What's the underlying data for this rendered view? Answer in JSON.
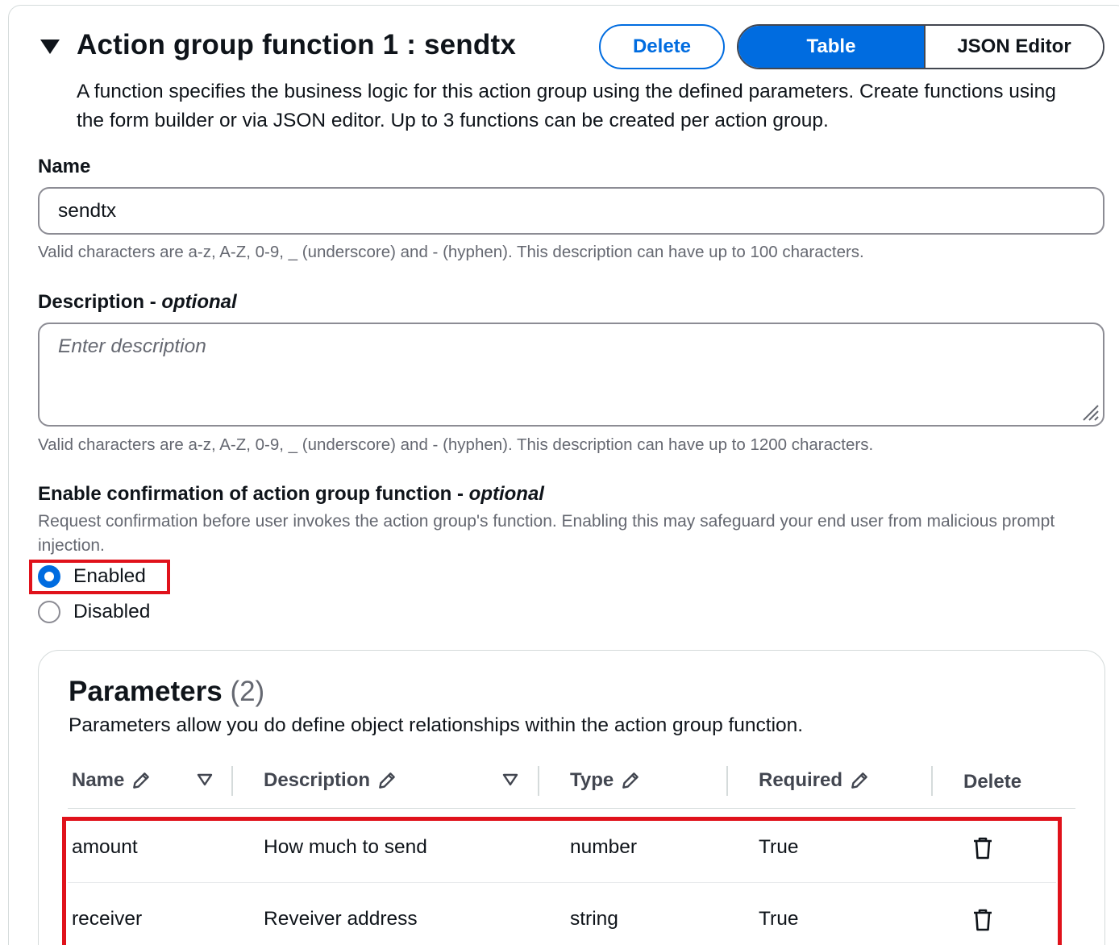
{
  "header": {
    "title": "Action group function 1 : sendtx",
    "delete_label": "Delete",
    "view_toggle": {
      "table_label": "Table",
      "json_label": "JSON Editor",
      "selected": "Table"
    },
    "description": "A function specifies the business logic for this action group using the defined parameters. Create functions using the form builder or via JSON editor. Up to 3 functions can be created per action group."
  },
  "name_field": {
    "label": "Name",
    "value": "sendtx",
    "hint": "Valid characters are a-z, A-Z, 0-9, _ (underscore) and - (hyphen). This description can have up to 100 characters."
  },
  "description_field": {
    "label": "Description - ",
    "label_optional": "optional",
    "placeholder": "Enter description",
    "hint": "Valid characters are a-z, A-Z, 0-9, _ (underscore) and - (hyphen). This description can have up to 1200 characters."
  },
  "confirmation": {
    "label": "Enable confirmation of action group function - ",
    "label_optional": "optional",
    "description": "Request confirmation before user invokes the action group's function. Enabling this may safeguard your end user from malicious prompt injection.",
    "options": [
      {
        "label": "Enabled",
        "checked": true
      },
      {
        "label": "Disabled",
        "checked": false
      }
    ]
  },
  "parameters": {
    "title": "Parameters",
    "count": "(2)",
    "description": "Parameters allow you do define object relationships within the action group function.",
    "columns": [
      "Name",
      "Description",
      "Type",
      "Required",
      "Delete"
    ],
    "rows": [
      {
        "name": "amount",
        "description": "How much to send",
        "type": "number",
        "required": "True"
      },
      {
        "name": "receiver",
        "description": "Reveiver address",
        "type": "string",
        "required": "True"
      }
    ]
  },
  "colors": {
    "accent": "#006ce0",
    "highlight": "#e0121b",
    "text": "#0f141a",
    "muted": "#656871"
  }
}
